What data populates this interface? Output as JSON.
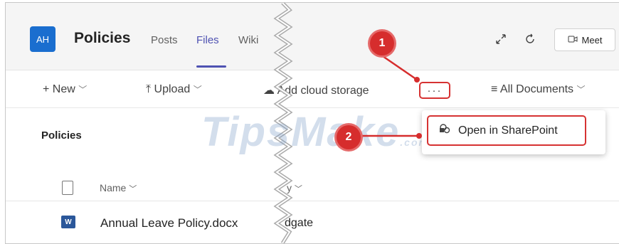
{
  "team": {
    "avatar": "AH",
    "title": "Policies"
  },
  "tabs": [
    {
      "label": "Posts"
    },
    {
      "label": "Files"
    },
    {
      "label": "Wiki"
    }
  ],
  "active_tab": "Files",
  "meet_label": "Meet",
  "commands": {
    "new": "New",
    "upload": "Upload",
    "add_storage": "Add cloud storage",
    "more": "···",
    "all_documents": "All Documents"
  },
  "breadcrumb": "Policies",
  "columns": {
    "name": "Name",
    "modified_fragment": "y"
  },
  "rows": [
    {
      "name": "Annual Leave Policy.docx",
      "modified_by_fragment": "dgate",
      "file_type": "W"
    }
  ],
  "context_menu": {
    "item": "Open in SharePoint"
  },
  "callouts": [
    "1",
    "2"
  ],
  "watermark": {
    "text": "TipsMake",
    "suffix": ".com"
  },
  "colors": {
    "accent": "#4f52b2",
    "callout": "#d62d2d",
    "word": "#2b579a"
  }
}
